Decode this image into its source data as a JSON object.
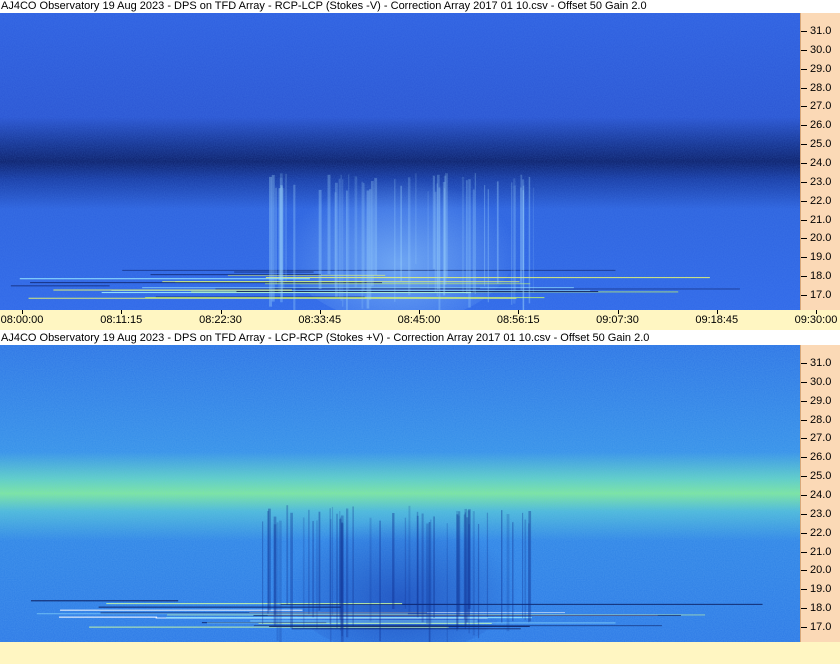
{
  "chart_data": [
    {
      "type": "heatmap",
      "title": "AJ4CO Observatory 19 Aug 2023  -  DPS on TFD Array  -  RCP-LCP (Stokes -V)  -  Correction Array 2017 01 10.csv  -  Offset 50  Gain 2.0",
      "y_ticks": [
        "31.0",
        "30.0",
        "29.0",
        "28.0",
        "27.0",
        "26.0",
        "25.0",
        "24.0",
        "23.0",
        "22.0",
        "21.0",
        "20.0",
        "19.0",
        "18.0",
        "17.0"
      ],
      "x_ticks": [
        "08:00:00",
        "08:11:15",
        "08:22:30",
        "08:33:45",
        "08:45:00",
        "08:56:15",
        "09:07:30",
        "09:18:45",
        "09:30:00"
      ],
      "colors": {
        "background": "#2f63e8",
        "dark_band": "#0b1f6e",
        "burst": "#78b8f4"
      }
    },
    {
      "type": "heatmap",
      "title": "AJ4CO Observatory 19 Aug 2023  -  DPS on TFD Array  -  LCP-RCP (Stokes +V)  -  Correction Array 2017 01 10.csv  -  Offset 50  Gain 2.0",
      "y_ticks": [
        "31.0",
        "30.0",
        "29.0",
        "28.0",
        "27.0",
        "26.0",
        "25.0",
        "24.0",
        "23.0",
        "22.0",
        "21.0",
        "20.0",
        "19.0",
        "18.0",
        "17.0"
      ],
      "x_ticks": [],
      "colors": {
        "background": "#2c78e6",
        "bright_band": "#8ef080",
        "burst": "#1a3fb8"
      }
    }
  ]
}
